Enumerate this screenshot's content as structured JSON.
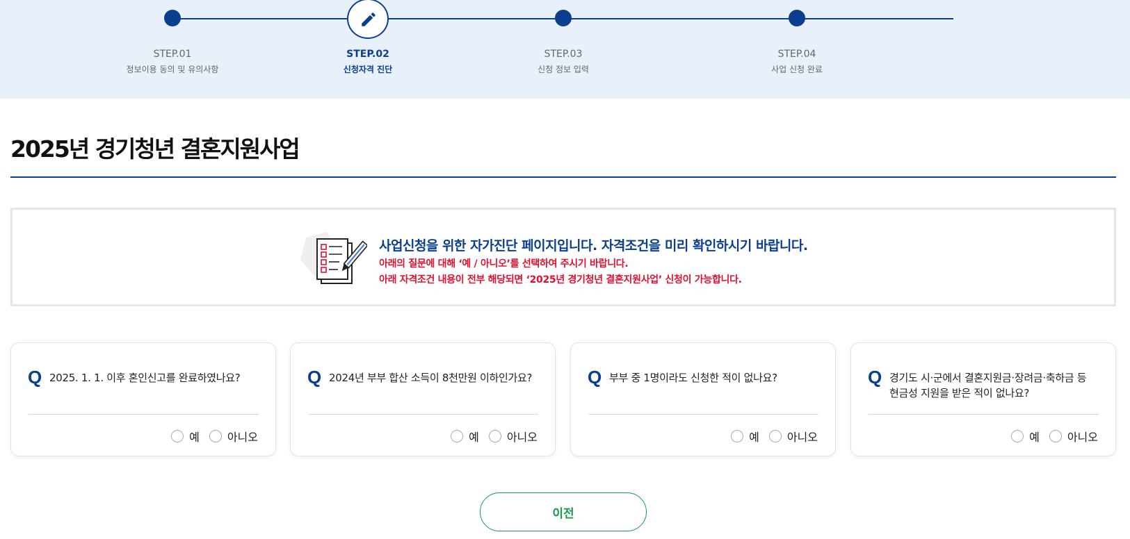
{
  "steps": [
    {
      "num": "STEP.01",
      "label": "정보이용 동의 및 유의사항"
    },
    {
      "num": "STEP.02",
      "label": "신청자격 진단"
    },
    {
      "num": "STEP.03",
      "label": "신청 정보 입력"
    },
    {
      "num": "STEP.04",
      "label": "사업 신청 완료"
    }
  ],
  "active_step": 2,
  "page_title": "2025년 경기청년 결혼지원사업",
  "notice": {
    "main": "사업신청을 위한 자가진단 페이지입니다. 자격조건을 미리 확인하시기 바랍니다.",
    "line1": "아래의 질문에 대해 ‘예 / 아니오’를 선택하여 주시기 바랍니다.",
    "line2": "아래 자격조건 내용이 전부 해당되면 ‘2025년 경기청년 결혼지원사업’ 신청이 가능합니다."
  },
  "questions": [
    {
      "q": "Q",
      "text": "2025. 1. 1. 이후 혼인신고를 완료하였나요?",
      "yes": "예",
      "no": "아니오"
    },
    {
      "q": "Q",
      "text": "2024년 부부 합산 소득이 8천만원 이하인가요?",
      "yes": "예",
      "no": "아니오"
    },
    {
      "q": "Q",
      "text": "부부 중 1명이라도 신청한 적이 없나요?",
      "yes": "예",
      "no": "아니오"
    },
    {
      "q": "Q",
      "text": "경기도 시·군에서 결혼지원금·장려금·축하금 등 현금성 지원을 받은 적이 없나요?",
      "yes": "예",
      "no": "아니오"
    }
  ],
  "prev_button": "이전",
  "colors": {
    "primary": "#0a3f8f",
    "accent_red": "#e0102f",
    "green": "#1a9b4a",
    "step_bg": "#e8f0fa"
  }
}
